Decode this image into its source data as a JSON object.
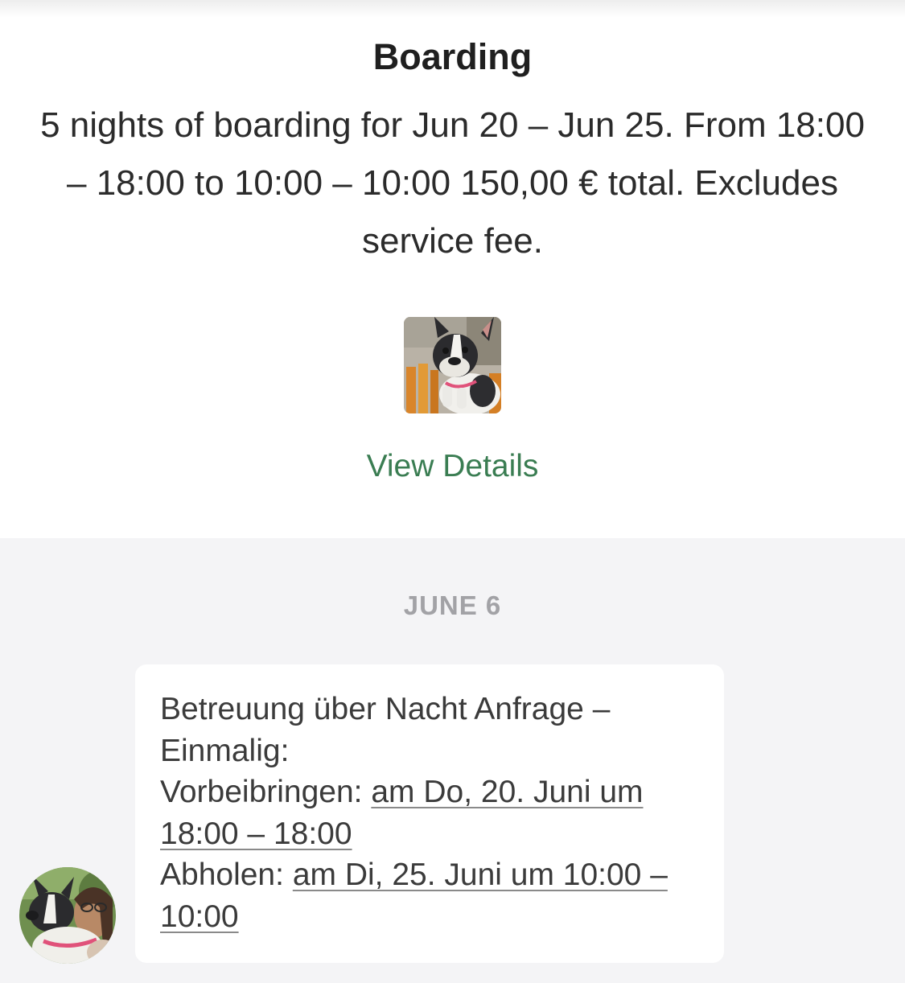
{
  "booking": {
    "title": "Boarding",
    "description": "5 nights of boarding for Jun 20 – Jun 25. From 18:00 – 18:00 to 10:00 – 10:00 150,00 € total. Excludes service fee.",
    "view_details_label": "View Details"
  },
  "chat": {
    "date_separator": "JUNE 6",
    "message": {
      "line1": "Betreuung über Nacht Anfrage – Einmalig:",
      "dropoff_label": "Vorbeibringen: ",
      "dropoff_value": "am Do, 20. Juni um 18:00 – 18:00",
      "pickup_label": "Abholen: ",
      "pickup_value": "am Di, 25. Juni um 10:00 – 10:00"
    }
  },
  "colors": {
    "accent_green": "#3a7d52",
    "chat_background": "#f4f4f6",
    "muted_text": "#a2a2a6"
  },
  "icons": {
    "pet_photo": "french-bulldog-photo",
    "avatar": "sitter-avatar-photo"
  }
}
